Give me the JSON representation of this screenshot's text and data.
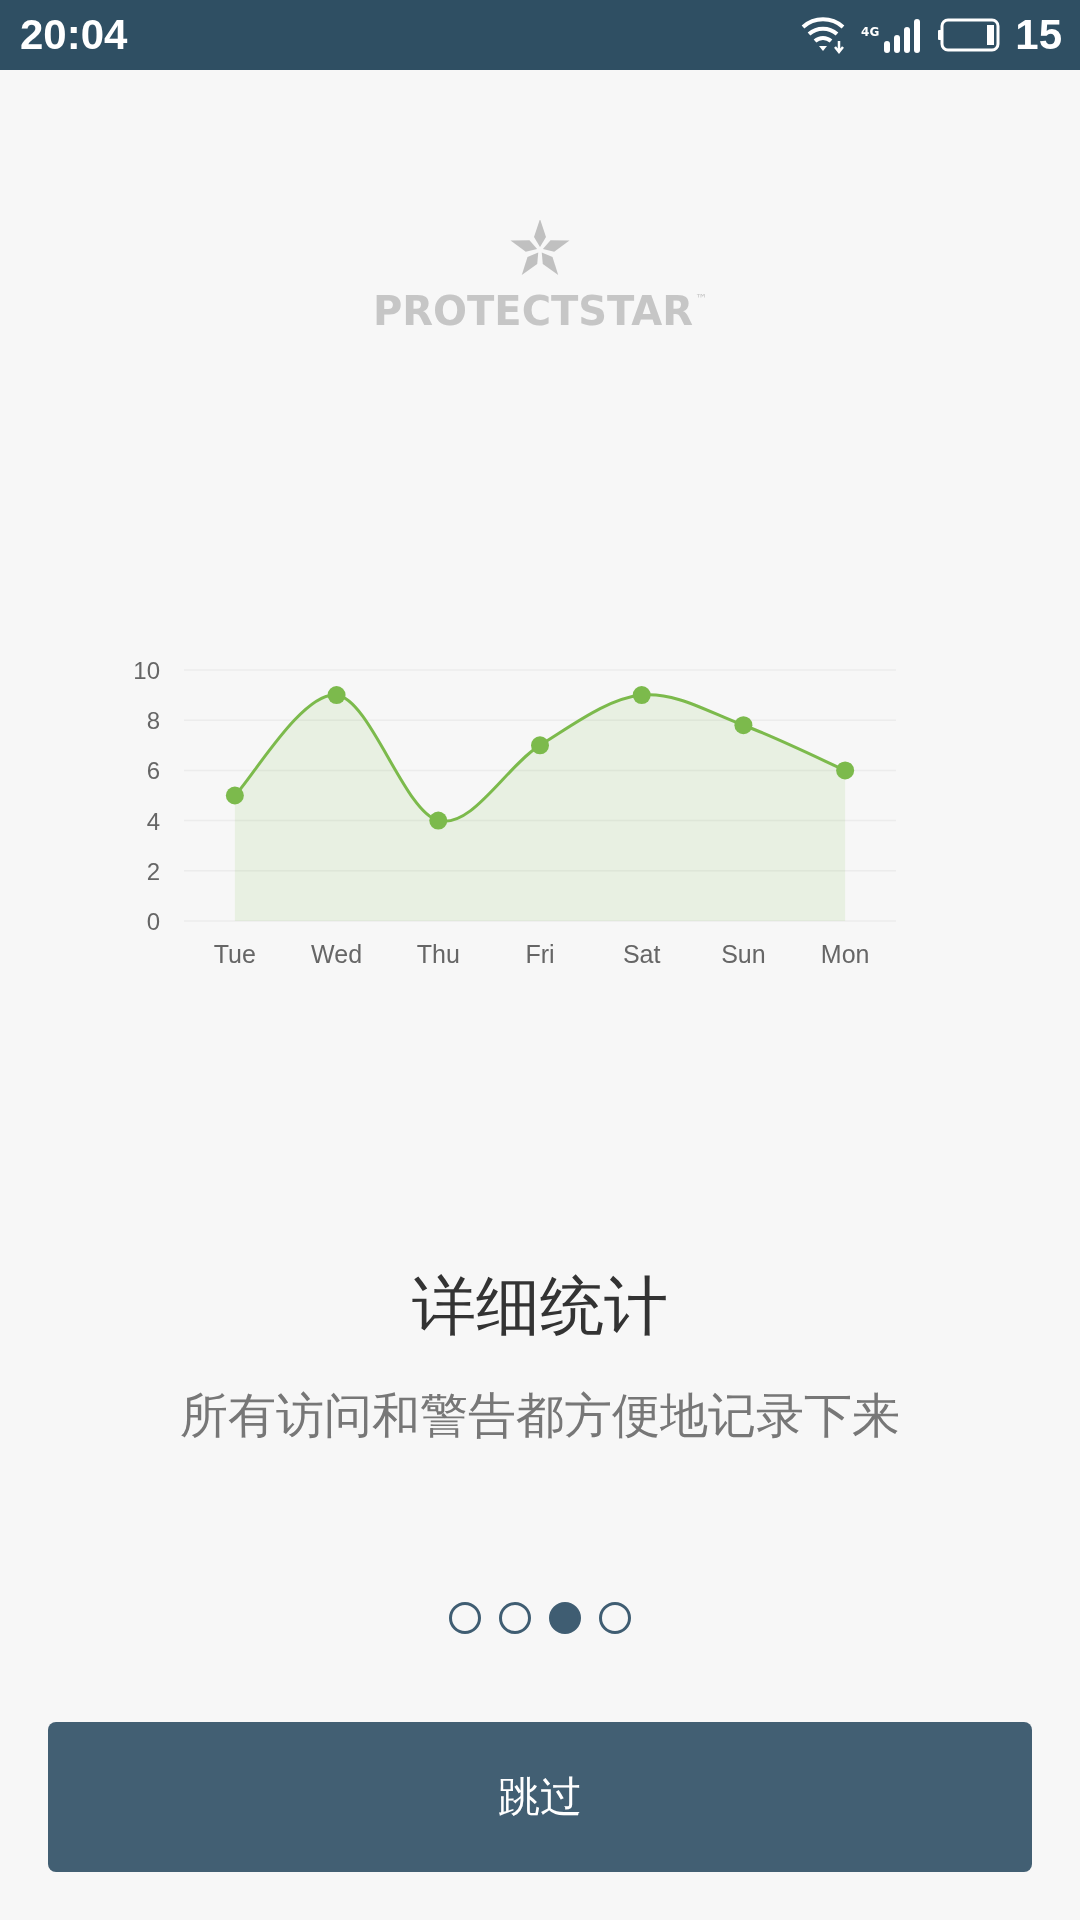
{
  "status_bar": {
    "time": "20:04",
    "network": "4G",
    "battery": "15"
  },
  "logo": {
    "text": "PROTECTSTAR",
    "trademark": "™"
  },
  "chart_data": {
    "type": "area",
    "categories": [
      "Tue",
      "Wed",
      "Thu",
      "Fri",
      "Sat",
      "Sun",
      "Mon"
    ],
    "series": [
      {
        "color": "#7cba4c",
        "values": [
          5,
          9,
          4,
          7,
          9,
          7.8,
          6
        ]
      }
    ],
    "grid": true,
    "ylim": [
      0,
      10
    ],
    "yticks": [
      0,
      2,
      4,
      6,
      8,
      10
    ]
  },
  "title": "详细统计",
  "subtitle": "所有访问和警告都方便地记录下来",
  "pages": [
    {
      "selected": false
    },
    {
      "selected": false
    },
    {
      "selected": true
    },
    {
      "selected": false
    }
  ],
  "skip_button": "跳过"
}
